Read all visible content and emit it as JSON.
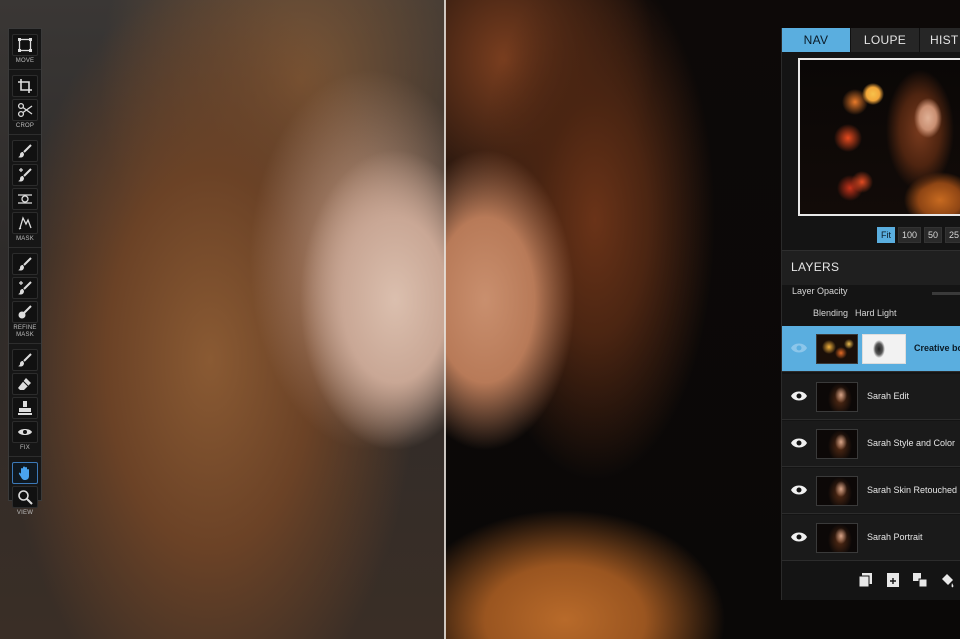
{
  "toolbar": {
    "groups": [
      {
        "label": "MOVE",
        "tools": [
          "transform-icon"
        ]
      },
      {
        "label": "CROP",
        "tools": [
          "crop-icon",
          "scissors-icon"
        ]
      },
      {
        "label": "MASK",
        "tools": [
          "brush-icon",
          "brush-plus-icon",
          "gradient-icon",
          "lasso-icon"
        ]
      },
      {
        "label": "REFINE\nMASK",
        "tools": [
          "refine-brush-icon",
          "refine-brush-plus-icon",
          "refine-brush-fill-icon"
        ]
      },
      {
        "label": "FIX",
        "tools": [
          "retouch-icon",
          "eraser-icon",
          "stamp-icon",
          "eye-icon"
        ]
      },
      {
        "label": "VIEW",
        "tools": [
          "hand-icon",
          "zoom-icon"
        ]
      }
    ]
  },
  "panel": {
    "tabs": [
      {
        "label": "NAV",
        "active": true
      },
      {
        "label": "LOUPE",
        "active": false
      },
      {
        "label": "HIST",
        "active": false
      }
    ],
    "zoom_levels": [
      "Fit",
      "100",
      "50",
      "25"
    ],
    "zoom_active": "Fit",
    "layers_title": "LAYERS",
    "opacity_label": "Layer Opacity",
    "blending_label": "Blending",
    "blending_value": "Hard Light",
    "layers": [
      {
        "name": "Creative bo",
        "selected": true,
        "visible": true
      },
      {
        "name": "Sarah Edit",
        "selected": false,
        "visible": true
      },
      {
        "name": "Sarah Style and Color",
        "selected": false,
        "visible": true
      },
      {
        "name": "Sarah Skin Retouched",
        "selected": false,
        "visible": true
      },
      {
        "name": "Sarah Portrait",
        "selected": false,
        "visible": true
      }
    ],
    "bottom_icons": [
      "new-layer-icon",
      "duplicate-layer-icon",
      "merge-layers-icon",
      "fill-icon"
    ]
  },
  "colors": {
    "accent": "#5aaedf",
    "panel_bg": "#141414",
    "toolbar_bg": "#161616"
  }
}
